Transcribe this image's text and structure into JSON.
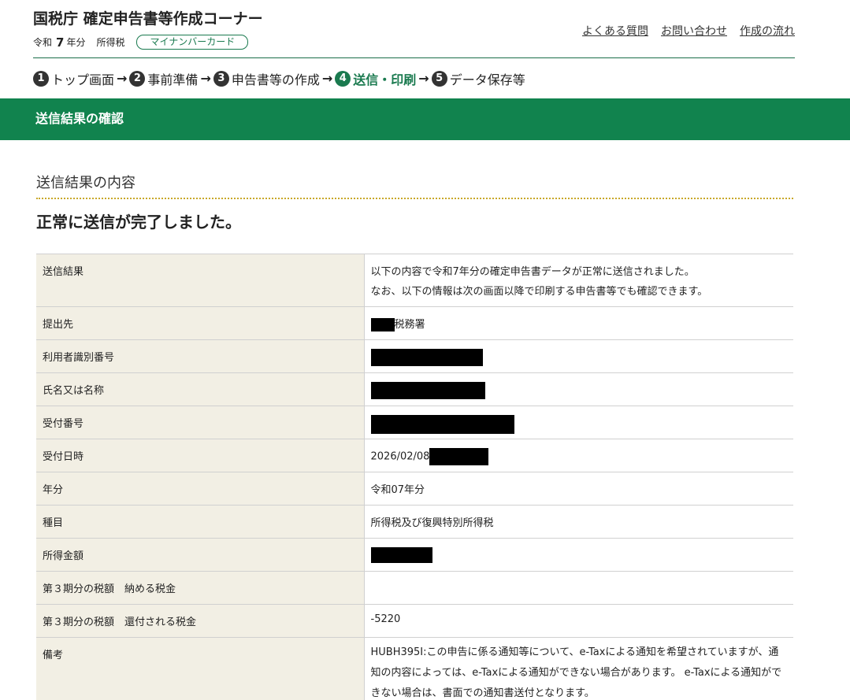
{
  "header": {
    "title": "国税庁 確定申告書等作成コーナー",
    "era": "令和",
    "year": "7",
    "year_suffix": "年分",
    "tax_type": "所得税",
    "badge": "マイナンバーカード",
    "links": [
      "よくある質問",
      "お問い合わせ",
      "作成の流れ"
    ]
  },
  "steps": [
    {
      "num": "1",
      "label": "トップ画面"
    },
    {
      "num": "2",
      "label": "事前準備"
    },
    {
      "num": "3",
      "label": "申告書等の作成"
    },
    {
      "num": "4",
      "label": "送信・印刷"
    },
    {
      "num": "5",
      "label": "データ保存等"
    }
  ],
  "section_title": "送信結果の確認",
  "result_heading": "送信結果の内容",
  "complete_message": "正常に送信が完了しました。",
  "rows": {
    "result": {
      "label": "送信結果",
      "line1": "以下の内容で令和7年分の確定申告書データが正常に送信されました。",
      "line2": "なお、以下の情報は次の画面以降で印刷する申告書等でも確認できます。"
    },
    "office": {
      "label": "提出先",
      "value": "税務署"
    },
    "user_id": {
      "label": "利用者識別番号"
    },
    "name": {
      "label": "氏名又は名称"
    },
    "receipt_no": {
      "label": "受付番号"
    },
    "received_at": {
      "label": "受付日時",
      "value": "2026/02/08"
    },
    "year": {
      "label": "年分",
      "value": "令和07年分"
    },
    "category": {
      "label": "種目",
      "value": "所得税及び復興特別所得税"
    },
    "income": {
      "label": "所得金額"
    },
    "tax_due": {
      "label": "第３期分の税額　納める税金",
      "value": ""
    },
    "refund": {
      "label": "第３期分の税額　還付される税金",
      "value": "-5220"
    },
    "remarks": {
      "label": "備考",
      "value": "HUBH395I:この申告に係る通知等について、e-Taxによる通知を希望されていますが、通知の内容によっては、e-Taxによる通知ができない場合があります。 e-Taxによる通知ができない場合は、書面での通知書送付となります。"
    }
  }
}
